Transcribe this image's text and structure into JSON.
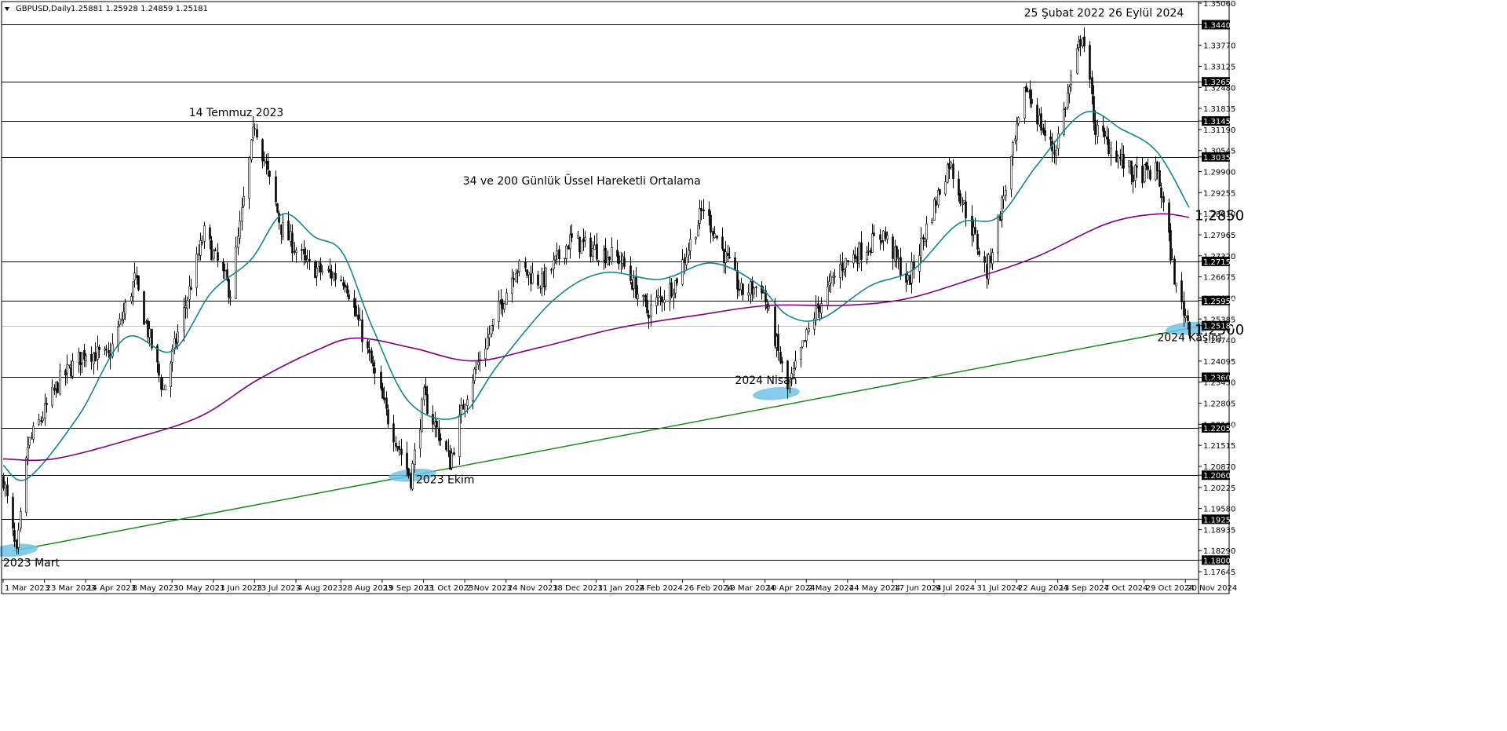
{
  "header": {
    "symbol": "GBPUSD,Daily",
    "ohlc": "1.25881 1.25928 1.24859 1.25181"
  },
  "colors": {
    "candle": "#000000",
    "grid": "#000000",
    "ema34": "#14868c",
    "ema200": "#800080",
    "trend": "#1a8a1a",
    "highlight": "#6fc3e6",
    "current": "#bfbfbf"
  },
  "chart_data": {
    "type": "candlestick",
    "title": "34 ve 200 Günlük Üssel Hareketli Ortalama",
    "xlabel": "",
    "ylabel": "",
    "x_range": [
      "2023-03-01",
      "2024-11-22"
    ],
    "ylim": [
      1.1743,
      1.3506
    ],
    "price_ticks": [
      "1.35060",
      "1.34400",
      "1.33770",
      "1.33125",
      "1.32480",
      "1.32650",
      "1.31835",
      "1.31450",
      "1.31190",
      "1.30545",
      "1.30350",
      "1.29900",
      "1.29255",
      "1.28610",
      "1.27965",
      "1.27320",
      "1.27150",
      "1.26675",
      "1.26030",
      "1.25950",
      "1.25385",
      "1.25181",
      "1.24740",
      "1.24095",
      "1.23600",
      "1.23450",
      "1.22805",
      "1.22160",
      "1.22050",
      "1.21515",
      "1.20870",
      "1.20600",
      "1.20225",
      "1.19580",
      "1.19250",
      "1.18935",
      "1.18290",
      "1.18000",
      "1.17645"
    ],
    "date_ticks": [
      {
        "date": "2023-03-01",
        "label": "1 Mar 2023"
      },
      {
        "date": "2023-03-23",
        "label": "23 Mar 2023"
      },
      {
        "date": "2023-04-14",
        "label": "14 Apr 2023"
      },
      {
        "date": "2023-05-08",
        "label": "8 May 2023"
      },
      {
        "date": "2023-05-30",
        "label": "30 May 2023"
      },
      {
        "date": "2023-06-21",
        "label": "21 Jun 2023"
      },
      {
        "date": "2023-07-13",
        "label": "13 Jul 2023"
      },
      {
        "date": "2023-08-04",
        "label": "4 Aug 2023"
      },
      {
        "date": "2023-08-28",
        "label": "28 Aug 2023"
      },
      {
        "date": "2023-09-19",
        "label": "19 Sep 2023"
      },
      {
        "date": "2023-10-11",
        "label": "11 Oct 2023"
      },
      {
        "date": "2023-11-02",
        "label": "2 Nov 2023"
      },
      {
        "date": "2023-11-24",
        "label": "24 Nov 2023"
      },
      {
        "date": "2023-12-18",
        "label": "18 Dec 2023"
      },
      {
        "date": "2024-01-11",
        "label": "11 Jan 2024"
      },
      {
        "date": "2024-02-02",
        "label": "2 Feb 2024"
      },
      {
        "date": "2024-02-26",
        "label": "26 Feb 2024"
      },
      {
        "date": "2024-03-19",
        "label": "19 Mar 2024"
      },
      {
        "date": "2024-04-10",
        "label": "10 Apr 2024"
      },
      {
        "date": "2024-05-02",
        "label": "2 May 2024"
      },
      {
        "date": "2024-05-24",
        "label": "24 May 2024"
      },
      {
        "date": "2024-06-17",
        "label": "17 Jun 2024"
      },
      {
        "date": "2024-07-09",
        "label": "9 Jul 2024"
      },
      {
        "date": "2024-07-31",
        "label": "31 Jul 2024"
      },
      {
        "date": "2024-08-22",
        "label": "22 Aug 2024"
      },
      {
        "date": "2024-09-13",
        "label": "13 Sep 2024"
      },
      {
        "date": "2024-10-07",
        "label": "7 Oct 2024"
      },
      {
        "date": "2024-10-29",
        "label": "29 Oct 2024"
      },
      {
        "date": "2024-11-20",
        "label": "20 Nov 2024"
      }
    ],
    "horizontal_levels": [
      "1.34400",
      "1.32650",
      "1.31450",
      "1.30350",
      "1.27150",
      "1.25950",
      "1.23600",
      "1.22050",
      "1.20600",
      "1.19250",
      "1.18000"
    ],
    "current_price": "1.25181",
    "price_path": [
      {
        "date": "2023-03-01",
        "price": 1.205
      },
      {
        "date": "2023-03-08",
        "price": 1.181
      },
      {
        "date": "2023-03-14",
        "price": 1.215
      },
      {
        "date": "2023-03-31",
        "price": 1.235
      },
      {
        "date": "2023-04-14",
        "price": 1.244
      },
      {
        "date": "2023-04-26",
        "price": 1.242
      },
      {
        "date": "2023-05-10",
        "price": 1.266
      },
      {
        "date": "2023-05-25",
        "price": 1.232
      },
      {
        "date": "2023-06-16",
        "price": 1.28
      },
      {
        "date": "2023-06-30",
        "price": 1.262
      },
      {
        "date": "2023-07-13",
        "price": 1.314
      },
      {
        "date": "2023-07-27",
        "price": 1.282
      },
      {
        "date": "2023-08-10",
        "price": 1.27
      },
      {
        "date": "2023-08-30",
        "price": 1.266
      },
      {
        "date": "2023-09-21",
        "price": 1.225
      },
      {
        "date": "2023-10-04",
        "price": 1.205
      },
      {
        "date": "2023-10-11",
        "price": 1.23
      },
      {
        "date": "2023-10-25",
        "price": 1.21
      },
      {
        "date": "2023-11-02",
        "price": 1.23
      },
      {
        "date": "2023-11-29",
        "price": 1.27
      },
      {
        "date": "2023-12-13",
        "price": 1.265
      },
      {
        "date": "2023-12-28",
        "price": 1.278
      },
      {
        "date": "2024-01-24",
        "price": 1.272
      },
      {
        "date": "2024-02-07",
        "price": 1.256
      },
      {
        "date": "2024-02-22",
        "price": 1.265
      },
      {
        "date": "2024-03-08",
        "price": 1.288
      },
      {
        "date": "2024-03-28",
        "price": 1.262
      },
      {
        "date": "2024-04-08",
        "price": 1.264
      },
      {
        "date": "2024-04-22",
        "price": 1.232
      },
      {
        "date": "2024-05-06",
        "price": 1.255
      },
      {
        "date": "2024-05-20",
        "price": 1.27
      },
      {
        "date": "2024-06-12",
        "price": 1.28
      },
      {
        "date": "2024-06-25",
        "price": 1.265
      },
      {
        "date": "2024-07-17",
        "price": 1.302
      },
      {
        "date": "2024-08-06",
        "price": 1.268
      },
      {
        "date": "2024-08-20",
        "price": 1.305
      },
      {
        "date": "2024-08-27",
        "price": 1.325
      },
      {
        "date": "2024-09-06",
        "price": 1.31
      },
      {
        "date": "2024-09-11",
        "price": 1.305
      },
      {
        "date": "2024-09-26",
        "price": 1.342
      },
      {
        "date": "2024-10-03",
        "price": 1.312
      },
      {
        "date": "2024-10-23",
        "price": 1.298
      },
      {
        "date": "2024-11-05",
        "price": 1.299
      },
      {
        "date": "2024-11-11",
        "price": 1.278
      },
      {
        "date": "2024-11-15",
        "price": 1.263
      },
      {
        "date": "2024-11-22",
        "price": 1.2518
      }
    ],
    "series": [
      {
        "name": "34",
        "points": [
          {
            "date": "2023-03-01",
            "value": 1.209
          },
          {
            "date": "2023-03-14",
            "value": 1.205
          },
          {
            "date": "2023-04-10",
            "value": 1.224
          },
          {
            "date": "2023-05-05",
            "value": 1.248
          },
          {
            "date": "2023-05-30",
            "value": 1.244
          },
          {
            "date": "2023-06-20",
            "value": 1.262
          },
          {
            "date": "2023-07-11",
            "value": 1.272
          },
          {
            "date": "2023-07-28",
            "value": 1.286
          },
          {
            "date": "2023-08-14",
            "value": 1.279
          },
          {
            "date": "2023-08-29",
            "value": 1.274
          },
          {
            "date": "2023-09-14",
            "value": 1.251
          },
          {
            "date": "2023-10-04",
            "value": 1.228
          },
          {
            "date": "2023-10-30",
            "value": 1.224
          },
          {
            "date": "2023-11-20",
            "value": 1.24
          },
          {
            "date": "2023-12-20",
            "value": 1.26
          },
          {
            "date": "2024-01-15",
            "value": 1.268
          },
          {
            "date": "2024-02-14",
            "value": 1.266
          },
          {
            "date": "2024-03-12",
            "value": 1.271
          },
          {
            "date": "2024-04-05",
            "value": 1.265
          },
          {
            "date": "2024-04-22",
            "value": 1.255
          },
          {
            "date": "2024-05-10",
            "value": 1.254
          },
          {
            "date": "2024-06-05",
            "value": 1.264
          },
          {
            "date": "2024-06-28",
            "value": 1.269
          },
          {
            "date": "2024-07-22",
            "value": 1.283
          },
          {
            "date": "2024-08-12",
            "value": 1.285
          },
          {
            "date": "2024-09-02",
            "value": 1.301
          },
          {
            "date": "2024-09-27",
            "value": 1.317
          },
          {
            "date": "2024-10-17",
            "value": 1.312
          },
          {
            "date": "2024-11-05",
            "value": 1.305
          },
          {
            "date": "2024-11-22",
            "value": 1.288
          }
        ]
      },
      {
        "name": "200",
        "points": [
          {
            "date": "2023-03-01",
            "value": 1.211
          },
          {
            "date": "2023-03-28",
            "value": 1.211
          },
          {
            "date": "2023-05-08",
            "value": 1.217
          },
          {
            "date": "2023-06-14",
            "value": 1.224
          },
          {
            "date": "2023-07-14",
            "value": 1.235
          },
          {
            "date": "2023-08-14",
            "value": 1.244
          },
          {
            "date": "2023-09-05",
            "value": 1.248
          },
          {
            "date": "2023-10-05",
            "value": 1.245
          },
          {
            "date": "2023-11-06",
            "value": 1.241
          },
          {
            "date": "2023-12-11",
            "value": 1.245
          },
          {
            "date": "2024-01-22",
            "value": 1.251
          },
          {
            "date": "2024-03-05",
            "value": 1.255
          },
          {
            "date": "2024-04-12",
            "value": 1.258
          },
          {
            "date": "2024-05-21",
            "value": 1.258
          },
          {
            "date": "2024-06-24",
            "value": 1.26
          },
          {
            "date": "2024-07-29",
            "value": 1.266
          },
          {
            "date": "2024-09-02",
            "value": 1.273
          },
          {
            "date": "2024-10-09",
            "value": 1.283
          },
          {
            "date": "2024-11-05",
            "value": 1.286
          },
          {
            "date": "2024-11-22",
            "value": 1.285
          }
        ]
      }
    ],
    "trendline": {
      "from": {
        "date": "2023-03-08",
        "price": 1.183
      },
      "to": {
        "date": "2024-11-22",
        "price": 1.251
      }
    },
    "highlights": [
      {
        "date": "2023-03-07",
        "price": 1.183
      },
      {
        "date": "2023-10-05",
        "price": 1.206
      },
      {
        "date": "2024-04-16",
        "price": 1.231
      },
      {
        "date": "2024-11-22",
        "price": 1.251
      }
    ],
    "annotations": [
      {
        "text": "25 Şubat 2022  26 Eylül 2024",
        "date": "2024-08-26",
        "price": 1.3465
      },
      {
        "text": "14 Temmuz 2023",
        "date": "2023-06-08",
        "price": 1.316
      },
      {
        "text": "34 ve 200 Günlük Üssel Hareketli Ortalama",
        "date": "2023-11-01",
        "price": 1.295
      },
      {
        "text": "2024 Nisan",
        "date": "2024-03-25",
        "price": 1.234
      },
      {
        "text": "2023 Ekim",
        "date": "2023-10-07",
        "price": 1.2035
      },
      {
        "text": "2023 Mart",
        "date": "2023-03-01",
        "price": 1.178
      },
      {
        "text": "2024 Kasım",
        "date": "2024-11-05",
        "price": 1.247
      }
    ],
    "level_callouts": [
      {
        "text": "1,2850",
        "date": "2024-11-25",
        "price": 1.2855
      },
      {
        "text": "1,2500",
        "date": "2024-11-25",
        "price": 1.2505
      }
    ]
  }
}
